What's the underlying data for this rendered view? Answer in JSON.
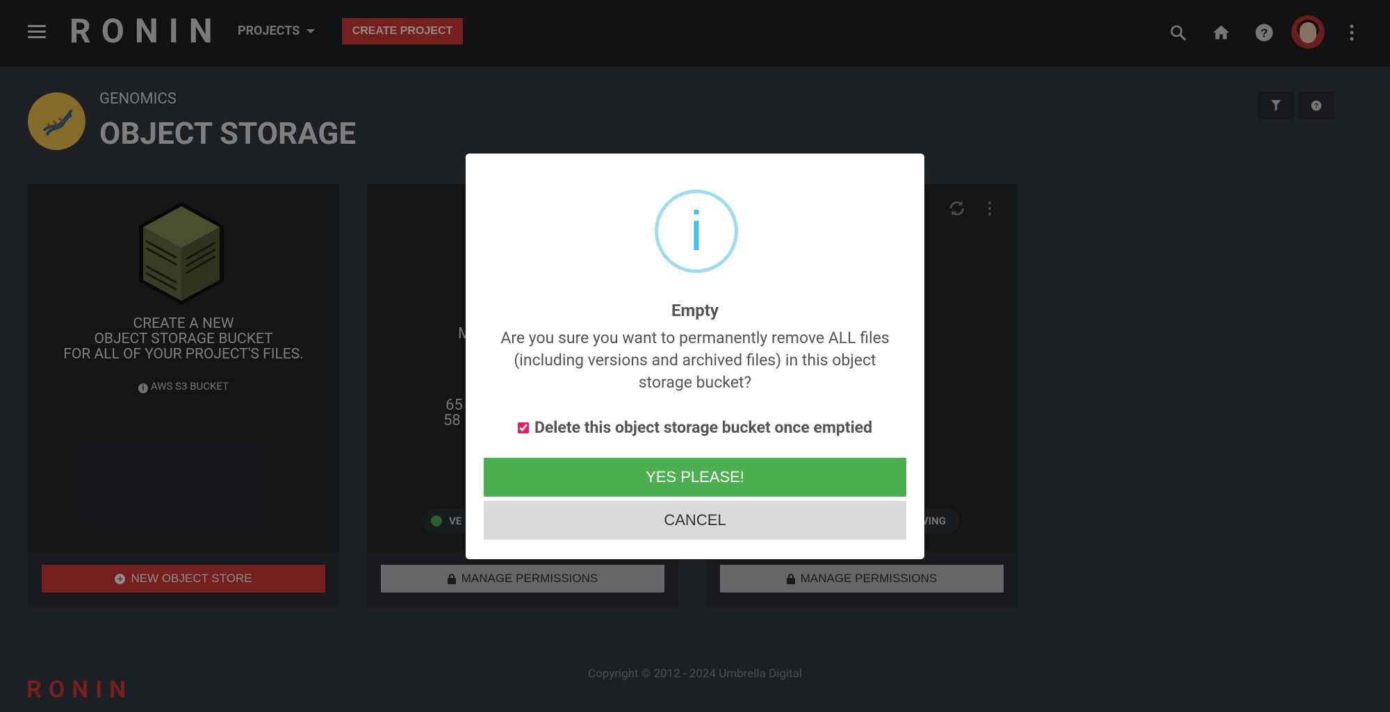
{
  "header": {
    "logo": "RONIN",
    "projects_label": "PROJECTS",
    "create_project_label": "CREATE PROJECT",
    "icons": [
      "menu-icon",
      "search-icon",
      "home-icon",
      "help-icon",
      "avatar",
      "more-vert-icon"
    ]
  },
  "page": {
    "eyebrow": "GENOMICS",
    "title": "OBJECT STORAGE",
    "header_icons": [
      "filter-icon",
      "help-icon"
    ]
  },
  "cards": {
    "create": {
      "text_line1": "CREATE A NEW",
      "text_line2": "OBJECT STORAGE BUCKET",
      "text_line3": "FOR ALL OF YOUR PROJECT'S FILES.",
      "type_label": "AWS S3 BUCKET",
      "button_label": "NEW OBJECT STORE"
    },
    "bucket1": {
      "partial_text1": "M",
      "partial_text2": "65",
      "partial_text3": "58",
      "status_label_partial": "VE",
      "button_label": "MANAGE PERMISSIONS"
    },
    "bucket2": {
      "status_label_partial": "VING",
      "button_label": "MANAGE PERMISSIONS"
    }
  },
  "footer": {
    "copyright": "Copyright © 2012 - 2024 Umbrella Digital",
    "logo": "RONIN"
  },
  "modal": {
    "icon": "info-icon",
    "icon_glyph": "i",
    "title": "Empty",
    "message": "Are you sure you want to permanently remove ALL files (including versions and archived files) in this object storage bucket?",
    "checkbox_label": "Delete this object storage bucket once emptied",
    "checkbox_checked": true,
    "confirm_label": "YES PLEASE!",
    "cancel_label": "CANCEL"
  },
  "colors": {
    "brand_red": "#d63a3a",
    "confirm_green": "#4caf50",
    "info_blue": "#3fc3ee"
  }
}
